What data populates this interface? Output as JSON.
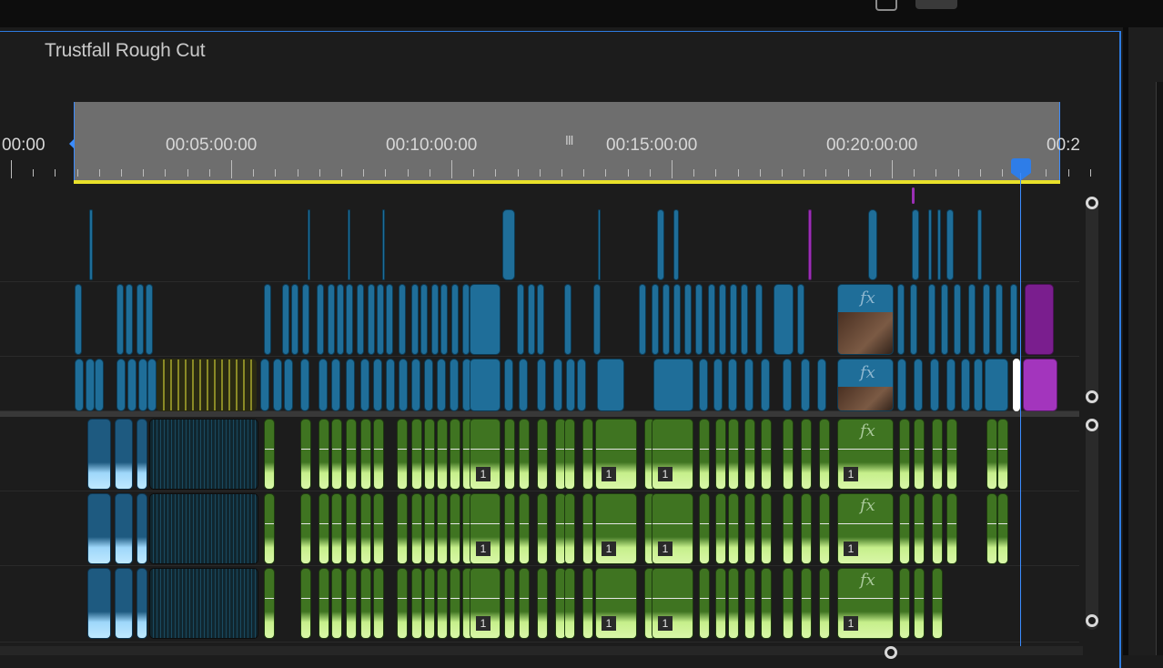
{
  "sequence": {
    "title": "Trustfall Rough Cut"
  },
  "ruler": {
    "timecodes": [
      "00:00",
      "00:05:00:00",
      "00:10:00:00",
      "00:15:00:00",
      "00:20:00:00",
      "00:2"
    ],
    "grip_label": "III"
  },
  "clip_labels": {
    "fx": "fx",
    "channel": "1"
  },
  "colors": {
    "accent": "#2d7be0",
    "video_clip": "#1f6e99",
    "audio_clip": "#3f7421",
    "nested_clip": "#9b2fb5",
    "work_area_bar": "#e9e12a"
  }
}
